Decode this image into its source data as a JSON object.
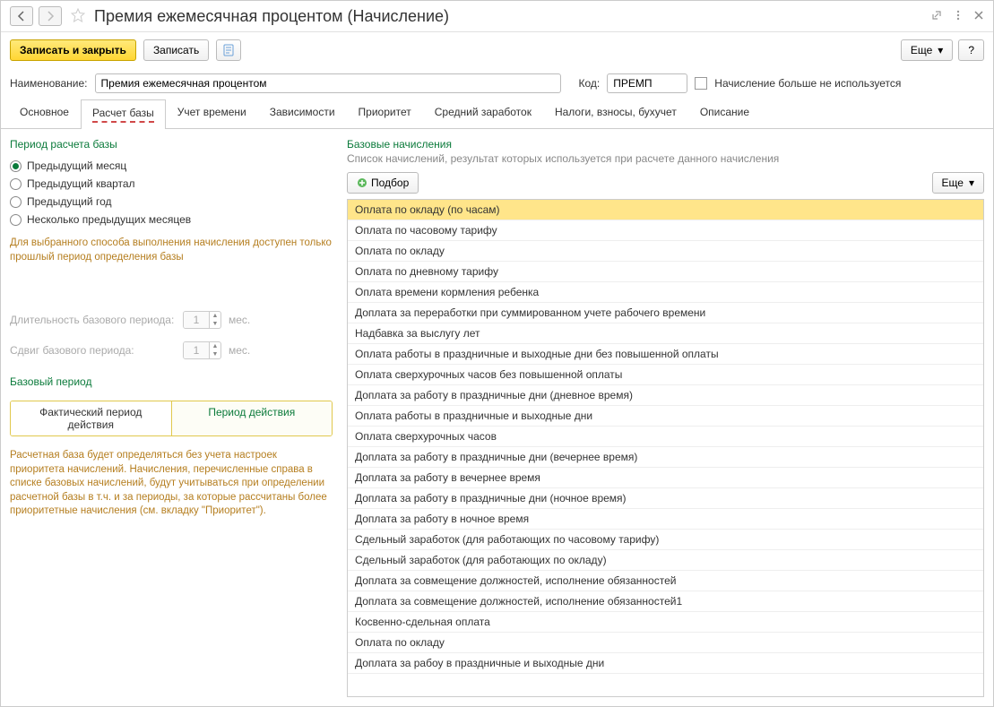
{
  "title": "Премия ежемесячная процентом (Начисление)",
  "toolbar": {
    "save_close": "Записать и закрыть",
    "save": "Записать",
    "more": "Еще",
    "help": "?"
  },
  "form": {
    "name_label": "Наименование:",
    "name_value": "Премия ежемесячная процентом",
    "code_label": "Код:",
    "code_value": "ПРЕМП",
    "unused_label": "Начисление больше не используется"
  },
  "tabs": [
    "Основное",
    "Расчет базы",
    "Учет времени",
    "Зависимости",
    "Приоритет",
    "Средний заработок",
    "Налоги, взносы, бухучет",
    "Описание"
  ],
  "left": {
    "period_title": "Период расчета базы",
    "radios": [
      "Предыдущий месяц",
      "Предыдущий квартал",
      "Предыдущий год",
      "Несколько предыдущих месяцев"
    ],
    "radio_hint": "Для выбранного способа выполнения начисления доступен только прошлый период определения базы",
    "dur_label": "Длительность базового периода:",
    "dur_value": "1",
    "dur_unit": "мес.",
    "shift_label": "Сдвиг базового периода:",
    "shift_value": "1",
    "shift_unit": "мес.",
    "base_period_title": "Базовый период",
    "seg_actual": "Фактический период действия",
    "seg_period": "Период действия",
    "seg_hint": "Расчетная база будет определяться без учета настроек приоритета начислений. Начисления, перечисленные справа в списке базовых начислений, будут учитываться при определении расчетной базы в т.ч. и за периоды, за которые рассчитаны более приоритетные начисления (см. вкладку \"Приоритет\")."
  },
  "right": {
    "title": "Базовые начисления",
    "subtitle": "Список начислений, результат которых используется при расчете данного начисления",
    "pick": "Подбор",
    "more": "Еще",
    "items": [
      "Оплата по окладу (по часам)",
      "Оплата по часовому тарифу",
      "Оплата по окладу",
      "Оплата по дневному тарифу",
      "Оплата времени кормления ребенка",
      "Доплата за переработки при суммированном учете рабочего времени",
      "Надбавка за выслугу лет",
      "Оплата работы в праздничные и выходные дни без повышенной оплаты",
      "Оплата сверхурочных часов без повышенной оплаты",
      "Доплата за работу в праздничные дни (дневное время)",
      "Оплата работы в праздничные и выходные дни",
      "Оплата сверхурочных часов",
      "Доплата за работу в праздничные дни (вечернее время)",
      "Доплата за работу в вечернее время",
      "Доплата за работу в праздничные дни (ночное время)",
      "Доплата за работу в ночное время",
      "Сдельный заработок (для работающих по часовому тарифу)",
      "Сдельный заработок (для работающих по окладу)",
      "Доплата за совмещение должностей, исполнение обязанностей",
      "Доплата за совмещение должностей, исполнение обязанностей1",
      "Косвенно-сдельная оплата",
      "Оплата по окладу",
      "Доплата за рабоу в праздничные и выходные дни"
    ]
  }
}
